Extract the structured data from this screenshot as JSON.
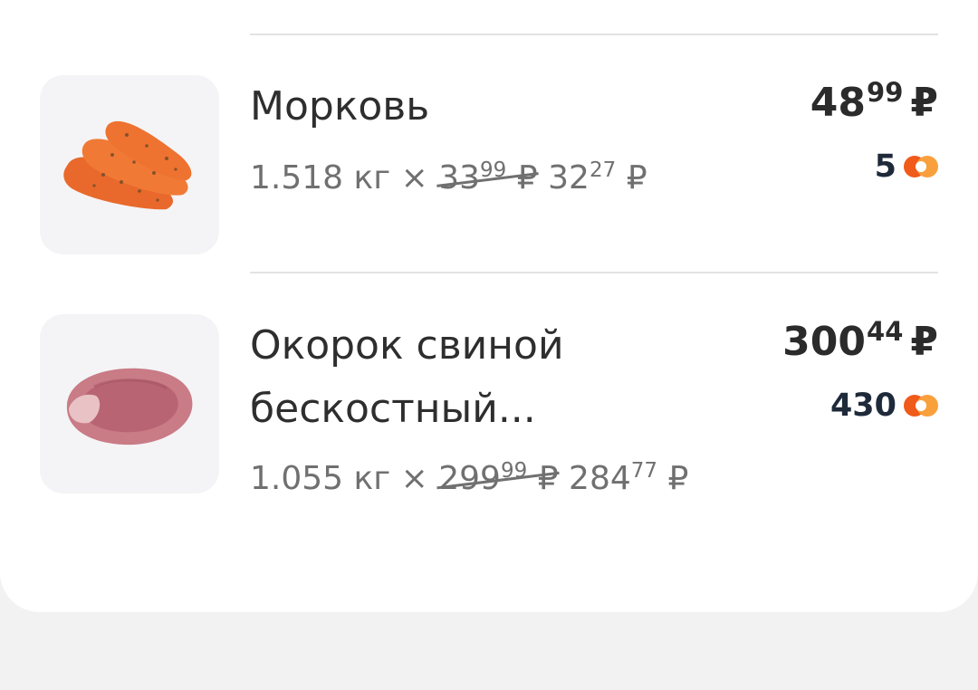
{
  "items": [
    {
      "name": "Морковь",
      "name_line2": "",
      "weight": "1.518 кг ×",
      "old_price_int": "33",
      "old_price_dec": "99",
      "new_price_int": "32",
      "new_price_dec": "27",
      "currency": "₽",
      "total_int": "48",
      "total_dec": "99",
      "bonus": "5",
      "image": "carrot-image"
    },
    {
      "name": "Окорок свиной",
      "name_line2": "бескостный...",
      "weight": "1.055 кг ×",
      "old_price_int": "299",
      "old_price_dec": "99",
      "new_price_int": "284",
      "new_price_dec": "77",
      "currency": "₽",
      "total_int": "300",
      "total_dec": "44",
      "bonus": "430",
      "image": "pork-ham-image"
    }
  ],
  "colors": {
    "coin_orange": "#f05a1a",
    "coin_light": "#f9a03c",
    "bonus_text": "#1e2a3a"
  }
}
